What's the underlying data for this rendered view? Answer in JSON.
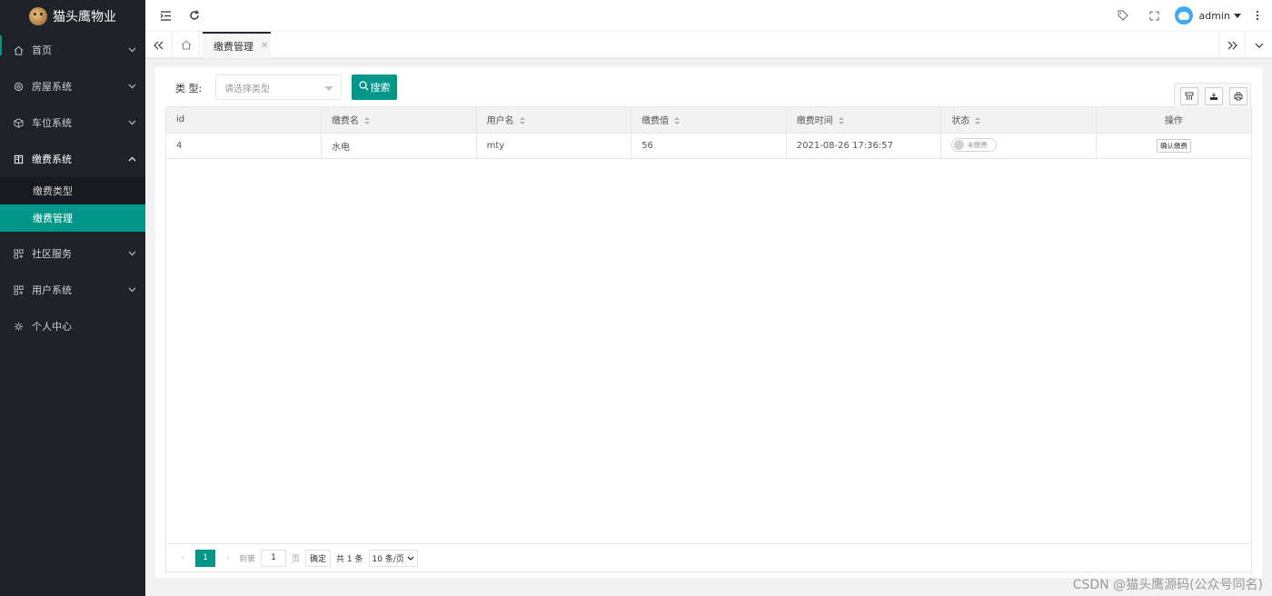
{
  "app": {
    "title": "猫头鹰物业"
  },
  "sidebar": {
    "items": [
      {
        "label": "首页",
        "icon": "home-icon"
      },
      {
        "label": "房屋系统",
        "icon": "settings-icon"
      },
      {
        "label": "车位系统",
        "icon": "cube-icon"
      },
      {
        "label": "缴费系统",
        "icon": "book-icon",
        "open": true,
        "children": [
          {
            "label": "缴费类型"
          },
          {
            "label": "缴费管理",
            "active": true
          }
        ]
      },
      {
        "label": "社区服务",
        "icon": "grid-icon"
      },
      {
        "label": "用户系统",
        "icon": "grid-icon"
      },
      {
        "label": "个人中心",
        "icon": "gear-icon"
      }
    ]
  },
  "header": {
    "user": "admin"
  },
  "tabs": [
    {
      "label": "缴费管理"
    }
  ],
  "filter": {
    "label": "类 型:",
    "placeholder": "请选择类型",
    "search_label": "搜索"
  },
  "table": {
    "columns": [
      "id",
      "缴费名",
      "用户名",
      "缴费值",
      "缴费时间",
      "状态",
      "操作"
    ],
    "rows": [
      {
        "id": "4",
        "name": "水电",
        "user": "mty",
        "value": "56",
        "time": "2021-08-26 17:36:57",
        "status": "未缴费",
        "action": "确认缴费"
      }
    ]
  },
  "pager": {
    "current": "1",
    "goto_label": "到第",
    "goto_value": "1",
    "page_label": "页",
    "confirm_label": "确定",
    "total": "共 1 条",
    "page_size": "10 条/页"
  },
  "watermark": "CSDN @猫头鹰源码(公众号同名)",
  "colors": {
    "accent": "#009688",
    "sidebar_bg": "#20222a"
  }
}
